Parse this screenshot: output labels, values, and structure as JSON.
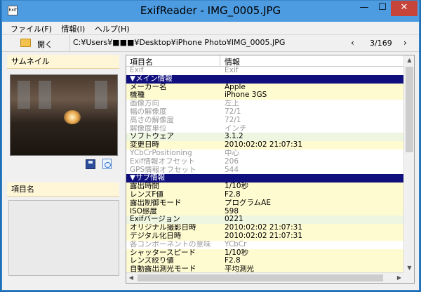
{
  "window": {
    "title": "ExifReader - IMG_0005.JPG",
    "icon_label": "Exif",
    "controls": {
      "minimize": "—",
      "maximize": "☐",
      "close": "✕"
    }
  },
  "menu": [
    {
      "label": "ファイル(F)"
    },
    {
      "label": "情報(I)"
    },
    {
      "label": "ヘルプ(H)"
    }
  ],
  "toolbar": {
    "open_label": "開く",
    "path": "C:¥Users¥■■■¥Desktop¥iPhone Photo¥IMG_0005.JPG",
    "prev": "‹",
    "counter": "3/169",
    "next": "›"
  },
  "left": {
    "thumbnail_label": "サムネイル",
    "item_name_label": "項目名"
  },
  "grid": {
    "col_name": "項目名",
    "col_info": "情報",
    "rows": [
      {
        "k": "Exif",
        "v": "Exif",
        "t": "dim"
      },
      {
        "k": "▼メイン情報",
        "v": "",
        "t": "sec"
      },
      {
        "k": "メーカー名",
        "v": "Apple",
        "t": "y"
      },
      {
        "k": "機種",
        "v": "iPhone 3GS",
        "t": "y"
      },
      {
        "k": "画像方向",
        "v": "左上",
        "t": "dim"
      },
      {
        "k": "幅の解像度",
        "v": "72/1",
        "t": "dim"
      },
      {
        "k": "高さの解像度",
        "v": "72/1",
        "t": "dim"
      },
      {
        "k": "解像度単位",
        "v": "インチ",
        "t": "dim"
      },
      {
        "k": "ソフトウェア",
        "v": "3.1.2",
        "t": "g"
      },
      {
        "k": "変更日時",
        "v": "2010:02:02 21:07:31",
        "t": "y"
      },
      {
        "k": "YCbCrPositioning",
        "v": "中心",
        "t": "dim"
      },
      {
        "k": "Exif情報オフセット",
        "v": "206",
        "t": "dim"
      },
      {
        "k": "GPS情報オフセット",
        "v": "544",
        "t": "dim"
      },
      {
        "k": "▼サブ情報",
        "v": "",
        "t": "sec"
      },
      {
        "k": "露出時間",
        "v": "1/10秒",
        "t": "y"
      },
      {
        "k": "レンズF値",
        "v": "F2.8",
        "t": "y"
      },
      {
        "k": "露出制御モード",
        "v": "プログラムAE",
        "t": "y"
      },
      {
        "k": "ISO感度",
        "v": "598",
        "t": "y"
      },
      {
        "k": "Exifバージョン",
        "v": "0221",
        "t": "g"
      },
      {
        "k": "オリジナル撮影日時",
        "v": "2010:02:02 21:07:31",
        "t": "y"
      },
      {
        "k": "デジタル化日時",
        "v": "2010:02:02 21:07:31",
        "t": "y"
      },
      {
        "k": "各コンポーネントの意味",
        "v": "YCbCr",
        "t": "dim"
      },
      {
        "k": "シャッタースピード",
        "v": "1/10秒",
        "t": "y"
      },
      {
        "k": "レンズ絞り値",
        "v": "F2.8",
        "t": "y"
      },
      {
        "k": "自動露出測光モード",
        "v": "平均測光",
        "t": "y"
      }
    ]
  }
}
